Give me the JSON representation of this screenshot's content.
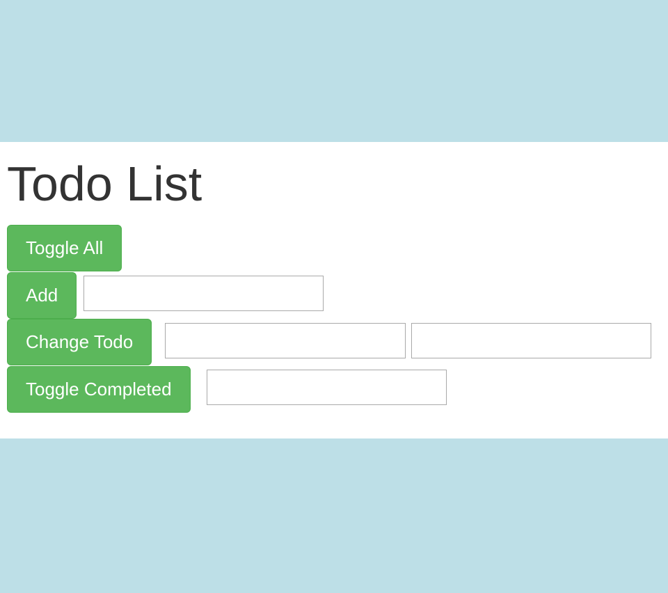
{
  "header": {
    "title": "Todo List"
  },
  "controls": {
    "toggle_all": {
      "label": "Toggle All"
    },
    "add": {
      "label": "Add",
      "text_value": ""
    },
    "change_todo": {
      "label": "Change Todo",
      "position_value": "",
      "text_value": ""
    },
    "toggle_completed": {
      "label": "Toggle Completed",
      "position_value": ""
    }
  },
  "colors": {
    "page_background": "#bddfe7",
    "content_background": "#ffffff",
    "button_green": "#5cb85c",
    "title_text": "#333333"
  }
}
